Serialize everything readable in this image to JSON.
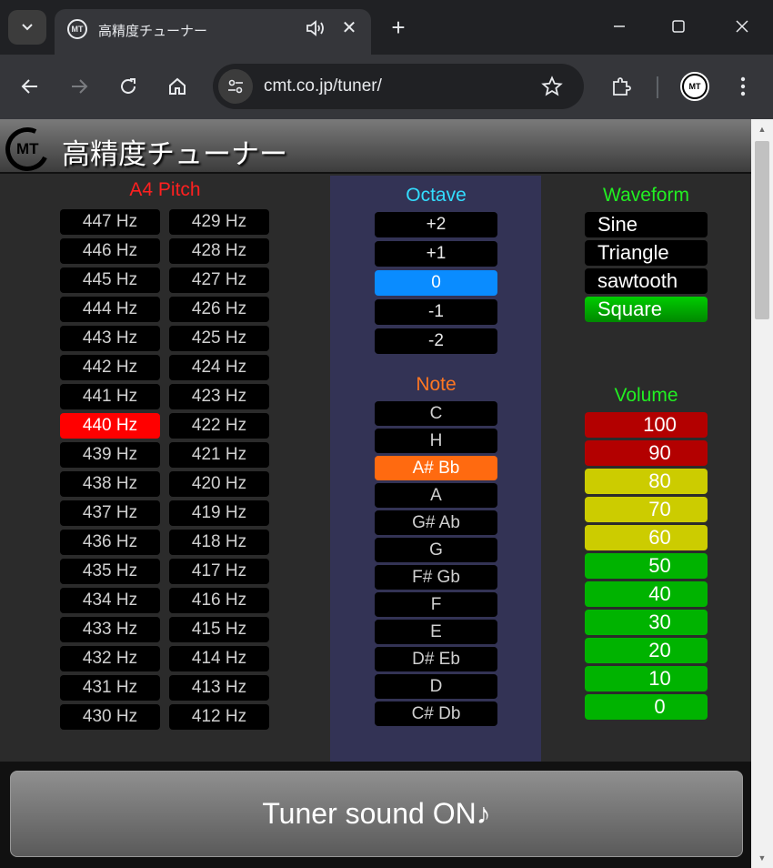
{
  "browser": {
    "tab_title": "高精度チューナー",
    "favicon_text": "MT",
    "url": "cmt.co.jp/tuner/",
    "new_tab_symbol": "+",
    "close_symbol": "✕"
  },
  "header": {
    "logo_text": "MT",
    "title": "高精度チューナー"
  },
  "a4_pitch": {
    "title": "A4 Pitch",
    "title_color": "#ff2020",
    "selected": "440 Hz",
    "selected_color": "#ff0000",
    "left_column": [
      "447 Hz",
      "446 Hz",
      "445 Hz",
      "444 Hz",
      "443 Hz",
      "442 Hz",
      "441 Hz",
      "440 Hz",
      "439 Hz",
      "438 Hz",
      "437 Hz",
      "436 Hz",
      "435 Hz",
      "434 Hz",
      "433 Hz",
      "432 Hz",
      "431 Hz",
      "430 Hz"
    ],
    "right_column": [
      "429 Hz",
      "428 Hz",
      "427 Hz",
      "426 Hz",
      "425 Hz",
      "424 Hz",
      "423 Hz",
      "422 Hz",
      "421 Hz",
      "420 Hz",
      "419 Hz",
      "418 Hz",
      "417 Hz",
      "416 Hz",
      "415 Hz",
      "414 Hz",
      "413 Hz",
      "412 Hz"
    ]
  },
  "octave": {
    "title": "Octave",
    "title_color": "#33ddff",
    "options": [
      "+2",
      "+1",
      "0",
      "-1",
      "-2"
    ],
    "selected": "0",
    "selected_color": "#0a8cff"
  },
  "note": {
    "title": "Note",
    "title_color": "#ff7722",
    "options": [
      "C",
      "H",
      "A# Bb",
      "A",
      "G# Ab",
      "G",
      "F# Gb",
      "F",
      "E",
      "D# Eb",
      "D",
      "C# Db"
    ],
    "selected": "A# Bb",
    "selected_color": "#ff6a10"
  },
  "waveform": {
    "title": "Waveform",
    "title_color": "#22ee22",
    "options": [
      "Sine",
      "Triangle",
      "sawtooth",
      "Square"
    ],
    "selected": "Square",
    "selected_color": "#00aa00"
  },
  "volume": {
    "title": "Volume",
    "title_color": "#22ee22",
    "levels": [
      {
        "label": "100",
        "color": "#b30000"
      },
      {
        "label": "90",
        "color": "#b30000"
      },
      {
        "label": "80",
        "color": "#cccc00"
      },
      {
        "label": "70",
        "color": "#cccc00"
      },
      {
        "label": "60",
        "color": "#cccc00"
      },
      {
        "label": "50",
        "color": "#00b300"
      },
      {
        "label": "40",
        "color": "#00b300"
      },
      {
        "label": "30",
        "color": "#00b300"
      },
      {
        "label": "20",
        "color": "#00b300"
      },
      {
        "label": "10",
        "color": "#00b300"
      },
      {
        "label": "0",
        "color": "#00b300"
      }
    ]
  },
  "sound_button": {
    "label": "Tuner sound ON♪"
  }
}
